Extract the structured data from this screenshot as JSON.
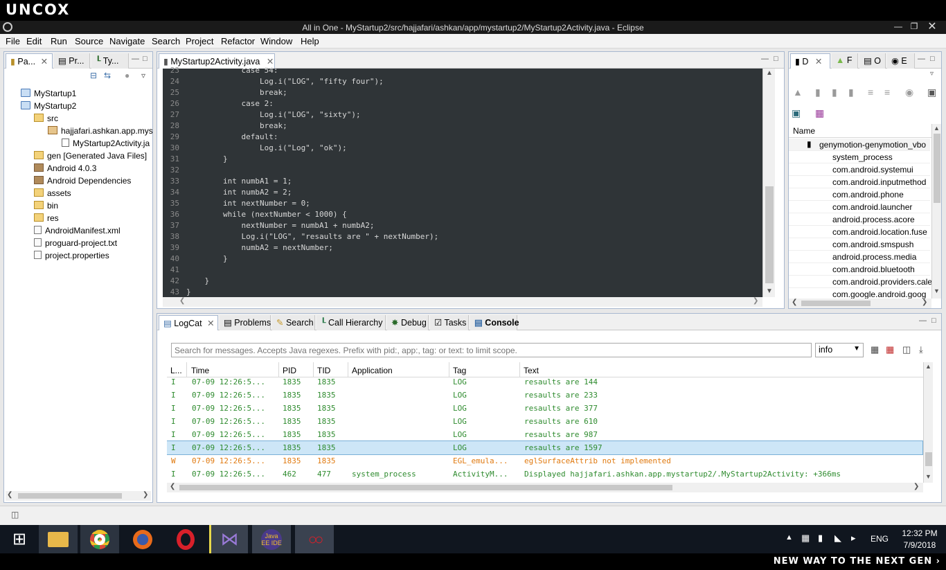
{
  "brand": {
    "logo_text": "UNCOX",
    "tagline": "NEW WAY TO THE NEXT GEN ›"
  },
  "window": {
    "title": "All in One - MyStartup2/src/hajjafari/ashkan/app/mystartup2/MyStartup2Activity.java - Eclipse"
  },
  "menu": [
    "File",
    "Edit",
    "Run",
    "Source",
    "Navigate",
    "Search",
    "Project",
    "Refactor",
    "Window",
    "Help"
  ],
  "left_panel": {
    "tabs": [
      "Pa...",
      "Pr...",
      "Ty..."
    ],
    "tree": [
      {
        "label": "MyStartup1",
        "icon": "project-icon"
      },
      {
        "label": "MyStartup2",
        "icon": "project-icon"
      },
      {
        "label": "src",
        "icon": "folder-icon"
      },
      {
        "label": "hajjafari.ashkan.app.mys",
        "icon": "package-icon"
      },
      {
        "label": "MyStartup2Activity.ja",
        "icon": "java-file-icon"
      },
      {
        "label": "gen [Generated Java Files]",
        "icon": "folder-icon"
      },
      {
        "label": "Android 4.0.3",
        "icon": "library-icon"
      },
      {
        "label": "Android Dependencies",
        "icon": "library-icon"
      },
      {
        "label": "assets",
        "icon": "folder-icon"
      },
      {
        "label": "bin",
        "icon": "folder-icon"
      },
      {
        "label": "res",
        "icon": "folder-icon"
      },
      {
        "label": "AndroidManifest.xml",
        "icon": "xml-file-icon"
      },
      {
        "label": "proguard-project.txt",
        "icon": "text-file-icon"
      },
      {
        "label": "project.properties",
        "icon": "text-file-icon"
      }
    ]
  },
  "editor": {
    "tab_label": "MyStartup2Activity.java",
    "line_numbers": [
      "23",
      "24",
      "25",
      "26",
      "27",
      "28",
      "29",
      "30",
      "31",
      "32",
      "33",
      "34",
      "35",
      "36",
      "37",
      "38",
      "39",
      "40",
      "41",
      "42",
      "43"
    ],
    "lines": [
      "            case 54:",
      "                Log.i(\"LOG\", \"fifty four\");",
      "                break;",
      "            case 2:",
      "                Log.i(\"LOG\", \"sixty\");",
      "                break;",
      "            default:",
      "                Log.i(\"Log\", \"ok\");",
      "        }",
      "",
      "        int numbA1 = 1;",
      "        int numbA2 = 2;",
      "        int nextNumber = 0;",
      "        while (nextNumber < 1000) {",
      "            nextNumber = numbA1 + numbA2;",
      "            Log.i(\"LOG\", \"resaults are \" + nextNumber);",
      "            numbA2 = nextNumber;",
      "        }",
      "",
      "    }",
      "}"
    ]
  },
  "devices_panel": {
    "tabs": [
      "D",
      "F",
      "O",
      "E"
    ],
    "column_header": "Name",
    "device": "genymotion-genymotion_vbo",
    "processes": [
      "system_process",
      "com.android.systemui",
      "com.android.inputmethod",
      "com.android.phone",
      "com.android.launcher",
      "android.process.acore",
      "com.android.location.fuse",
      "com.android.smspush",
      "android.process.media",
      "com.android.bluetooth",
      "com.android.providers.cale",
      "com.google.android.goog"
    ]
  },
  "bottom_panel": {
    "tabs": [
      "LogCat",
      "Problems",
      "Search",
      "Call Hierarchy",
      "Debug",
      "Tasks",
      "Console"
    ],
    "search_placeholder": "Search for messages. Accepts Java regexes. Prefix with pid:, app:, tag: or text: to limit scope.",
    "level_select": "info",
    "columns": [
      "L...",
      "Time",
      "PID",
      "TID",
      "Application",
      "Tag",
      "Text"
    ],
    "rows": [
      {
        "level": "I",
        "time": "07-09 12:26:5...",
        "pid": "1835",
        "tid": "1835",
        "app": "",
        "tag": "LOG",
        "text": "resaults are 144"
      },
      {
        "level": "I",
        "time": "07-09 12:26:5...",
        "pid": "1835",
        "tid": "1835",
        "app": "",
        "tag": "LOG",
        "text": "resaults are 233"
      },
      {
        "level": "I",
        "time": "07-09 12:26:5...",
        "pid": "1835",
        "tid": "1835",
        "app": "",
        "tag": "LOG",
        "text": "resaults are 377"
      },
      {
        "level": "I",
        "time": "07-09 12:26:5...",
        "pid": "1835",
        "tid": "1835",
        "app": "",
        "tag": "LOG",
        "text": "resaults are 610"
      },
      {
        "level": "I",
        "time": "07-09 12:26:5...",
        "pid": "1835",
        "tid": "1835",
        "app": "",
        "tag": "LOG",
        "text": "resaults are 987"
      },
      {
        "level": "I",
        "time": "07-09 12:26:5...",
        "pid": "1835",
        "tid": "1835",
        "app": "",
        "tag": "LOG",
        "text": "resaults are 1597",
        "selected": true
      },
      {
        "level": "W",
        "time": "07-09 12:26:5...",
        "pid": "1835",
        "tid": "1835",
        "app": "",
        "tag": "EGL_emula...",
        "text": "eglSurfaceAttrib not implemented"
      },
      {
        "level": "I",
        "time": "07-09 12:26:5...",
        "pid": "462",
        "tid": "477",
        "app": "system_process",
        "tag": "ActivityM...",
        "text": "Displayed hajjafari.ashkan.app.mystartup2/.MyStartup2Activity: +366ms"
      }
    ]
  },
  "taskbar": {
    "apps": [
      "start-icon",
      "file-explorer-icon",
      "chrome-icon",
      "firefox-icon",
      "opera-icon",
      "visual-studio-icon",
      "java-ee-ide-icon",
      "oo-app-icon"
    ],
    "java_ee_label": "Java EE IDE",
    "language": "ENG",
    "time": "12:32 PM",
    "date": "7/9/2018"
  },
  "colors": {
    "editor_bg": "#2f3437",
    "log_info": "#2e8b2e",
    "log_warn": "#e07a10",
    "selection": "#cde6f7"
  }
}
